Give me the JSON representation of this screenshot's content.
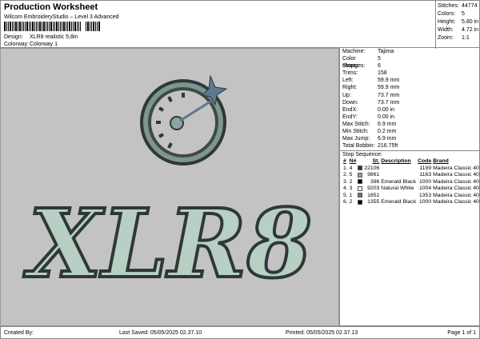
{
  "header": {
    "title": "Production Worksheet",
    "subtitle": "Wilcom EmbroideryStudio – Level 3 Advanced",
    "design_label": "Design:",
    "design_value": "XLR8 realistic 5,8in",
    "colorway_label": "Colorway:",
    "colorway_value": "Colorway 1"
  },
  "stats": [
    {
      "label": "Stitches:",
      "value": "44774"
    },
    {
      "label": "Colors:",
      "value": "5"
    },
    {
      "label": "Height:",
      "value": "5.80 in"
    },
    {
      "label": "Width:",
      "value": "4.72 in"
    },
    {
      "label": "Zoom:",
      "value": "1:1"
    }
  ],
  "info": [
    {
      "label": "Machine:",
      "value": "Tajima"
    },
    {
      "label": "Color changes:",
      "value": "5"
    },
    {
      "label": "Stops:",
      "value": "6"
    },
    {
      "label": "Trims:",
      "value": "158"
    },
    {
      "label": "Left:",
      "value": "59.9 mm"
    },
    {
      "label": "Right:",
      "value": "59.9 mm"
    },
    {
      "label": "Up:",
      "value": "73.7 mm"
    },
    {
      "label": "Down:",
      "value": "73.7 mm"
    },
    {
      "label": "EndX:",
      "value": "0.00 in"
    },
    {
      "label": "EndY:",
      "value": "0.00 in"
    },
    {
      "label": "Max Stitch:",
      "value": "6.9 mm"
    },
    {
      "label": "Min Stitch:",
      "value": "0.2 mm"
    },
    {
      "label": "Max Jump:",
      "value": "6.9 mm"
    },
    {
      "label": "Total Bobbin:",
      "value": "216.75ft"
    }
  ],
  "sequence": {
    "title": "Stop Sequence:",
    "headers": [
      "#",
      "N#",
      "St.",
      "Description",
      "Code",
      "Brand"
    ],
    "rows": [
      {
        "n": "1.",
        "num": "4",
        "color": "#2e3838",
        "st": "22106",
        "desc": "",
        "code": "1199",
        "brand": "Madeira Classic 40"
      },
      {
        "n": "2.",
        "num": "5",
        "color": "#8ea3a3",
        "st": "9861",
        "desc": "",
        "code": "1163",
        "brand": "Madeira Classic 40"
      },
      {
        "n": "3.",
        "num": "2",
        "color": "#000000",
        "st": "396",
        "desc": "Emerald Black",
        "code": "1000",
        "brand": "Madeira Classic 40"
      },
      {
        "n": "4.",
        "num": "3",
        "color": "#f2f2f2",
        "st": "9203",
        "desc": "Natural White",
        "code": "1004",
        "brand": "Madeira Classic 40"
      },
      {
        "n": "5.",
        "num": "1",
        "color": "#5b7a92",
        "st": "1851",
        "desc": "",
        "code": "1353",
        "brand": "Madeira Classic 40"
      },
      {
        "n": "6.",
        "num": "2",
        "color": "#000000",
        "st": "1355",
        "desc": "Emerald Black",
        "code": "1000",
        "brand": "Madeira Classic 40"
      }
    ]
  },
  "design_art": {
    "text": "XLR8"
  },
  "footer": {
    "created_by": "Created By:",
    "last_saved": "Last Saved: 05/05/2025 02.37.10",
    "printed": "Printed: 05/05/2025 02.37.13",
    "page": "Page 1 of 1"
  }
}
